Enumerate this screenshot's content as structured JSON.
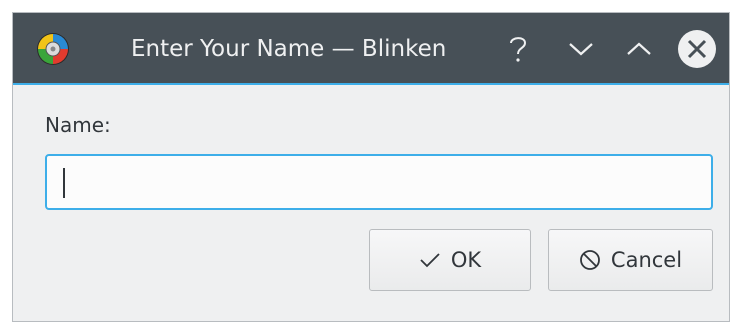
{
  "window": {
    "title": "Enter Your Name — Blinken",
    "app_icon": "blinken-app-icon",
    "buttons": {
      "help_icon": "help-icon",
      "minimize_icon": "chevron-down-icon",
      "maximize_icon": "chevron-up-icon",
      "close_icon": "close-icon"
    }
  },
  "form": {
    "name_label": "Name:",
    "name_value": "",
    "name_placeholder": ""
  },
  "actions": {
    "ok_label": "OK",
    "ok_icon": "check-icon",
    "cancel_label": "Cancel",
    "cancel_icon": "cancel-icon"
  },
  "colors": {
    "titlebar": "#475057",
    "accent": "#3daee9",
    "window_bg": "#eff0f1",
    "text": "#31363b"
  }
}
